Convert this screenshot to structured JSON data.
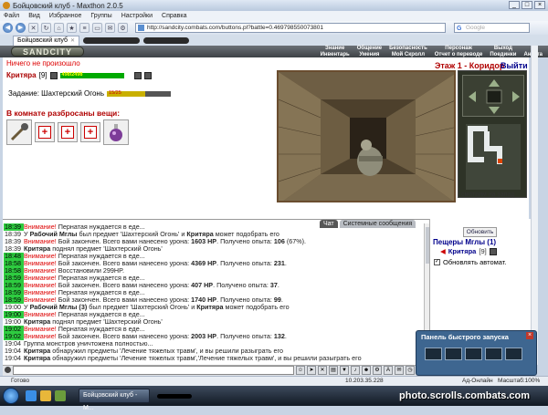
{
  "window": {
    "title": "Бойцовский клуб - Maxthon 2.0.5"
  },
  "menu": [
    "Файл",
    "Вид",
    "Избранное",
    "Группы",
    "Настройки",
    "Справка"
  ],
  "address": "http://sandcity.combats.com/buttons.pl?battle=0.469798550073801",
  "search_placeholder": "Google",
  "tab": {
    "label": "Бойцовский клуб"
  },
  "game": {
    "logo": "SANDCITY",
    "topmenu": [
      "Знание",
      "Общение",
      "Безопасность",
      "Персонаж",
      "Выход",
      "",
      "Инвентарь",
      "Умения",
      "Мой Скролл",
      "Отчет о переводе",
      "Поединки",
      "Анкета"
    ],
    "notice": "Ничего не произошло",
    "player": {
      "name": "Критяра",
      "level": "[9]",
      "hp_text": "498/2498",
      "hp_fraction": 1.0
    },
    "task": {
      "label": "Задание: Шахтерский Огонь",
      "progress_text": "15/25",
      "progress_fraction": 0.6
    },
    "things_title": "В комнате разбросаны вещи:",
    "floor": "Этаж 1 - Коридор",
    "exit_link": "Выйти",
    "look_direction": "смотрим на запад"
  },
  "chat": {
    "tabs": [
      "Чат",
      "Системные сообщения"
    ],
    "lines": [
      {
        "time": "18:39",
        "hl": true,
        "parts": [
          [
            "warn",
            "Внимание! "
          ],
          [
            "",
            "Пернатая нуждается в еде..."
          ]
        ]
      },
      {
        "time": "18:39",
        "hl": false,
        "parts": [
          [
            "",
            "У "
          ],
          [
            "bold",
            "Рабочий Мглы"
          ],
          [
            "",
            " был предмет 'Шахтерский Огонь' и "
          ],
          [
            "bold",
            "Критяра"
          ],
          [
            "",
            " может подобрать его"
          ]
        ]
      },
      {
        "time": "18:39",
        "hl": false,
        "parts": [
          [
            "warn",
            "Внимание! "
          ],
          [
            "",
            "Бой закончен. Всего вами нанесено урона: "
          ],
          [
            "bold",
            "1603 HP"
          ],
          [
            "",
            ". Получено опыта: "
          ],
          [
            "bold",
            "106"
          ],
          [
            "",
            " (67%)."
          ]
        ]
      },
      {
        "time": "18:39",
        "hl": false,
        "parts": [
          [
            "bold",
            "Критяра"
          ],
          [
            "",
            " поднял предмет 'Шахтерский Огонь'"
          ]
        ]
      },
      {
        "time": "18:48",
        "hl": true,
        "parts": [
          [
            "warn",
            "Внимание! "
          ],
          [
            "",
            "Пернатая нуждается в еде..."
          ]
        ]
      },
      {
        "time": "18:58",
        "hl": true,
        "parts": [
          [
            "warn",
            "Внимание! "
          ],
          [
            "",
            "Бой закончен. Всего вами нанесено урона: "
          ],
          [
            "bold",
            "4369 HP"
          ],
          [
            "",
            ". Получено опыта: "
          ],
          [
            "bold",
            "231"
          ],
          [
            "",
            "."
          ]
        ]
      },
      {
        "time": "18:58",
        "hl": true,
        "parts": [
          [
            "warn",
            "Внимание! "
          ],
          [
            "",
            "Восстановили 299HP."
          ]
        ]
      },
      {
        "time": "18:59",
        "hl": true,
        "parts": [
          [
            "warn",
            "Внимание! "
          ],
          [
            "",
            "Пернатая нуждается в еде..."
          ]
        ]
      },
      {
        "time": "18:59",
        "hl": true,
        "parts": [
          [
            "warn",
            "Внимание! "
          ],
          [
            "",
            "Бой закончен. Всего вами нанесено урона: "
          ],
          [
            "bold",
            "407 HP"
          ],
          [
            "",
            ". Получено опыта: "
          ],
          [
            "bold",
            "37"
          ],
          [
            "",
            "."
          ]
        ]
      },
      {
        "time": "18:59",
        "hl": true,
        "parts": [
          [
            "warn",
            "Внимание! "
          ],
          [
            "",
            "Пернатая нуждается в еде..."
          ]
        ]
      },
      {
        "time": "18:59",
        "hl": true,
        "parts": [
          [
            "warn",
            "Внимание! "
          ],
          [
            "",
            "Бой закончен. Всего вами нанесено урона: "
          ],
          [
            "bold",
            "1740 HP"
          ],
          [
            "",
            ". Получено опыта: "
          ],
          [
            "bold",
            "99"
          ],
          [
            "",
            "."
          ]
        ]
      },
      {
        "time": "19:00",
        "hl": false,
        "parts": [
          [
            "",
            "У "
          ],
          [
            "bold",
            "Рабочий Мглы (3)"
          ],
          [
            "",
            " был предмет 'Шахтерский Огонь' и "
          ],
          [
            "bold",
            "Критяра"
          ],
          [
            "",
            " может подобрать его"
          ]
        ]
      },
      {
        "time": "19:00",
        "hl": true,
        "parts": [
          [
            "warn",
            "Внимание! "
          ],
          [
            "",
            "Пернатая нуждается в еде..."
          ]
        ]
      },
      {
        "time": "19:00",
        "hl": false,
        "parts": [
          [
            "bold",
            "Критяра"
          ],
          [
            "",
            " поднял предмет 'Шахтерский Огонь'"
          ]
        ]
      },
      {
        "time": "19:02",
        "hl": true,
        "parts": [
          [
            "warn",
            "Внимание! "
          ],
          [
            "",
            "Пернатая нуждается в еде..."
          ]
        ]
      },
      {
        "time": "19:02",
        "hl": true,
        "parts": [
          [
            "warn",
            "Внимание! "
          ],
          [
            "",
            "Бой закончен. Всего вами нанесено урона: "
          ],
          [
            "bold",
            "2003 HP"
          ],
          [
            "",
            ". Получено опыта: "
          ],
          [
            "bold",
            "132"
          ],
          [
            "",
            "."
          ]
        ]
      },
      {
        "time": "19:04",
        "hl": false,
        "parts": [
          [
            "",
            "Группа монстров уничтожена полностью..."
          ]
        ]
      },
      {
        "time": "19:04",
        "hl": false,
        "parts": [
          [
            "bold",
            "Критяра"
          ],
          [
            "",
            " обнаружил предметы 'Лечение тяжелых травм', и вы решили разыграть его"
          ]
        ]
      },
      {
        "time": "19:04",
        "hl": false,
        "parts": [
          [
            "bold",
            "Критяра"
          ],
          [
            "",
            " обнаружил предметы 'Лечение тяжелых травм','Лечение тяжелых травм', и вы решили разыграть его"
          ]
        ]
      },
      {
        "time": "19:04",
        "hl": false,
        "parts": [
          [
            "bold",
            "Критяра"
          ],
          [
            "",
            " обнаружил предметы 'Флакончик маны', и вы решили разыграть его"
          ]
        ]
      }
    ]
  },
  "side": {
    "refresh": "Обновить",
    "caves": "Пещеры Мглы (1)",
    "member_name": "Критяра",
    "member_level": "[9]",
    "auto_update": "Обновлять автомат."
  },
  "quick": {
    "title": "Панель быстрого запуска"
  },
  "status": {
    "ready": "Готово",
    "ip": "10.203.35.228",
    "offline": "Ад-Онлайн",
    "zoom": "Масштаб:100%"
  },
  "taskbar": {
    "app": "Бойцовский клуб - M..."
  },
  "watermark": "photo.scrolls.combats.com",
  "colors": {
    "accent_red": "#b00000",
    "link_blue": "#00008b",
    "highlight_green": "#2ecc40"
  }
}
